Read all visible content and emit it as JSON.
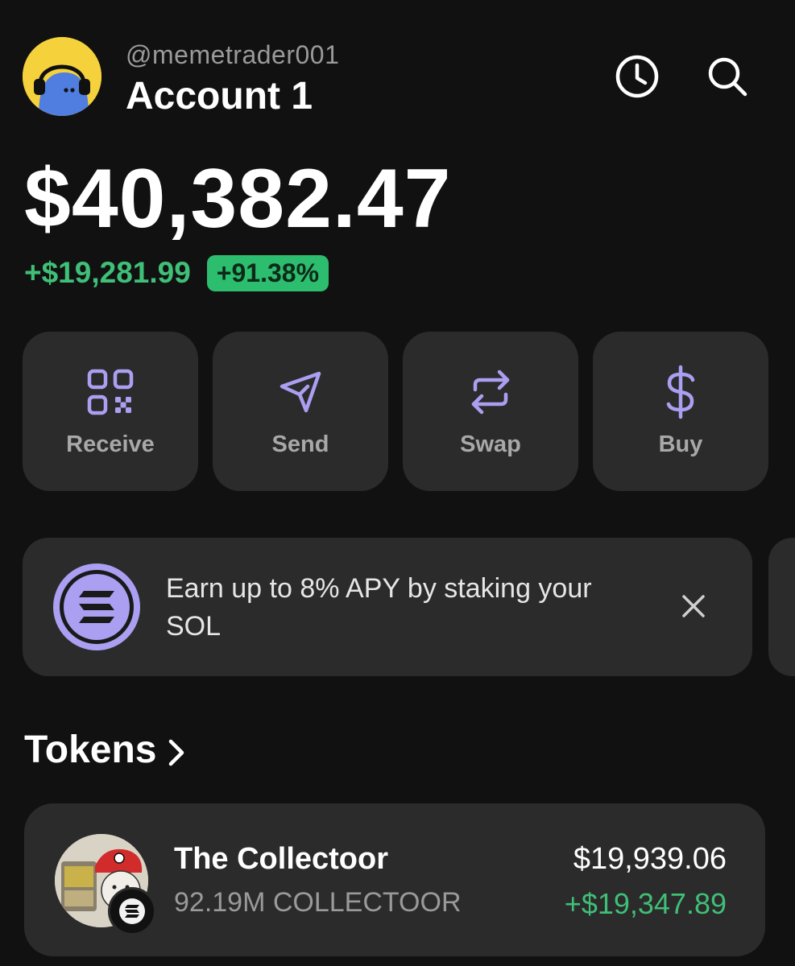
{
  "colors": {
    "background": "#111111",
    "card": "#2b2b2b",
    "accent_purple": "#ab9ff2",
    "positive_green": "#3fbf77",
    "badge_green": "#2dbd6e",
    "muted_text": "#9a9a9a"
  },
  "header": {
    "username": "@memetrader001",
    "account_name": "Account 1",
    "avatar_icon": "ghost-headphones-avatar",
    "history_icon": "clock-icon",
    "search_icon": "search-icon"
  },
  "balance": {
    "total": "$40,382.47",
    "change_value": "+$19,281.99",
    "change_percent": "+91.38%"
  },
  "actions": [
    {
      "label": "Receive",
      "icon": "qr-code-icon"
    },
    {
      "label": "Send",
      "icon": "paper-plane-icon"
    },
    {
      "label": "Swap",
      "icon": "swap-arrows-icon"
    },
    {
      "label": "Buy",
      "icon": "dollar-icon"
    }
  ],
  "promo": {
    "text": "Earn up to 8% APY by staking your SOL",
    "icon": "solana-icon",
    "close_icon": "close-icon"
  },
  "tokens": {
    "title": "Tokens",
    "chevron_icon": "chevron-right-icon",
    "items": [
      {
        "name": "The Collectoor",
        "amount": "92.19M COLLECTOOR",
        "value": "$19,939.06",
        "change": "+$19,347.89",
        "chain_icon": "solana-icon"
      }
    ]
  }
}
